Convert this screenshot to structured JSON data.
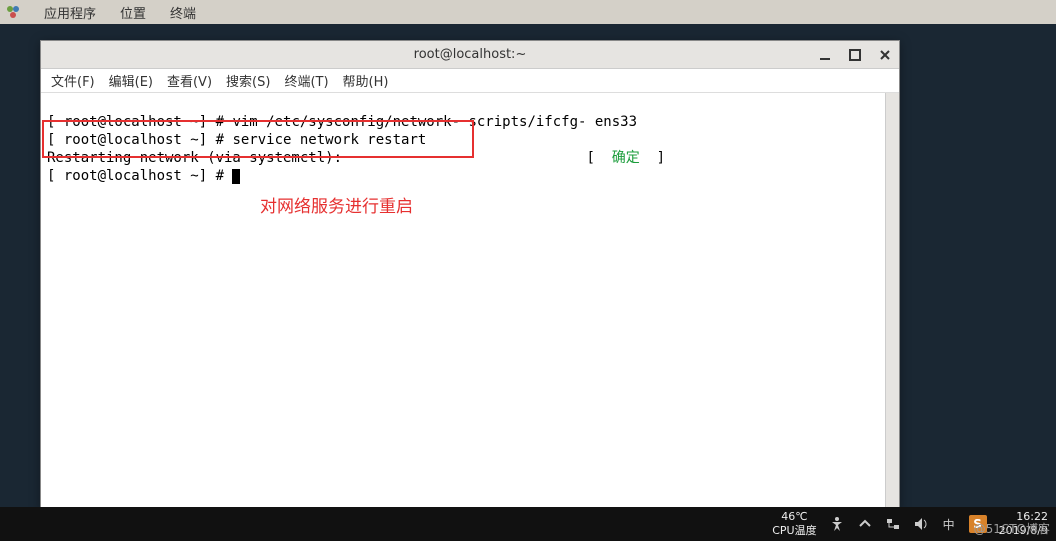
{
  "desktop": {
    "menu": {
      "apps": "应用程序",
      "places": "位置",
      "terminal": "终端"
    }
  },
  "window": {
    "title": "root@localhost:~",
    "menu": {
      "file": "文件(F)",
      "edit": "编辑(E)",
      "view": "查看(V)",
      "search": "搜索(S)",
      "terminal": "终端(T)",
      "help": "帮助(H)"
    }
  },
  "terminal": {
    "line1_prompt": "[ root@localhost ~] # ",
    "line1_cmd": "vim /etc/sysconfig/network- scripts/ifcfg- ens33",
    "line2_prompt": "[ root@localhost ~] # ",
    "line2_cmd": "service network restart",
    "line3a": "Restarting network (via systemctl):",
    "line3b_left": "[  ",
    "line3b_status": "确定",
    "line3b_right": "  ]",
    "line4_prompt": "[ root@localhost ~] # "
  },
  "annotation": "对网络服务进行重启",
  "taskbar": {
    "temp_value": "46℃",
    "temp_label": "CPU温度",
    "ime": "S",
    "lang": "中",
    "clock_time": "16:22",
    "clock_date": "2019/8/9"
  },
  "watermark": "@51CTO博客"
}
